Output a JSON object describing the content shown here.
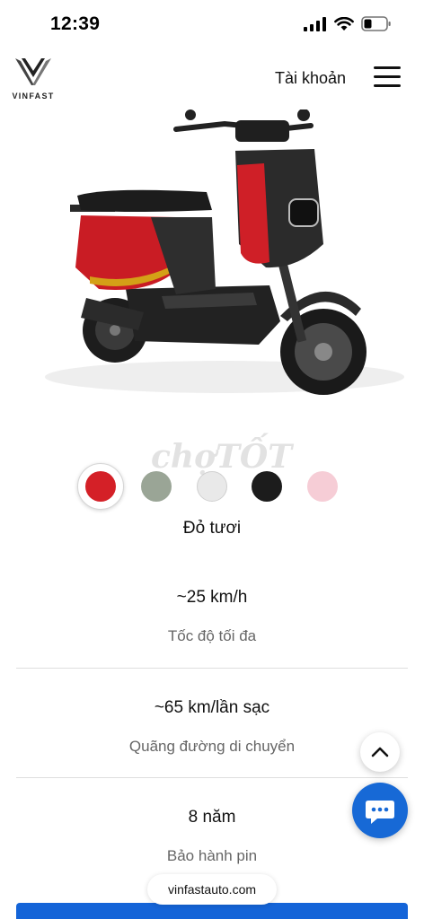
{
  "status_bar": {
    "time": "12:39"
  },
  "header": {
    "brand": "VINFAST",
    "account_label": "Tài khoản"
  },
  "product": {
    "colors": [
      {
        "name": "Đỏ tươi",
        "hex": "#d42027",
        "selected": true
      },
      {
        "name": "",
        "hex": "#9aa596",
        "selected": false
      },
      {
        "name": "",
        "hex": "#e9e9e9",
        "selected": false
      },
      {
        "name": "",
        "hex": "#1c1c1c",
        "selected": false
      },
      {
        "name": "",
        "hex": "#f6cdd6",
        "selected": false
      }
    ],
    "selected_color_name": "Đỏ tươi",
    "watermark": {
      "part1": "chợ",
      "part2": "TỐT"
    }
  },
  "specs": [
    {
      "value": "~25 km/h",
      "label": "Tốc độ tối đa"
    },
    {
      "value": "~65 km/lần sạc",
      "label": "Quãng đường di chuyển"
    },
    {
      "value": "8 năm",
      "label": "Bảo hành pin"
    }
  ],
  "browser": {
    "url": "vinfastauto.com"
  },
  "theme": {
    "accent": "#1769d6",
    "cta": "#1464d8"
  }
}
